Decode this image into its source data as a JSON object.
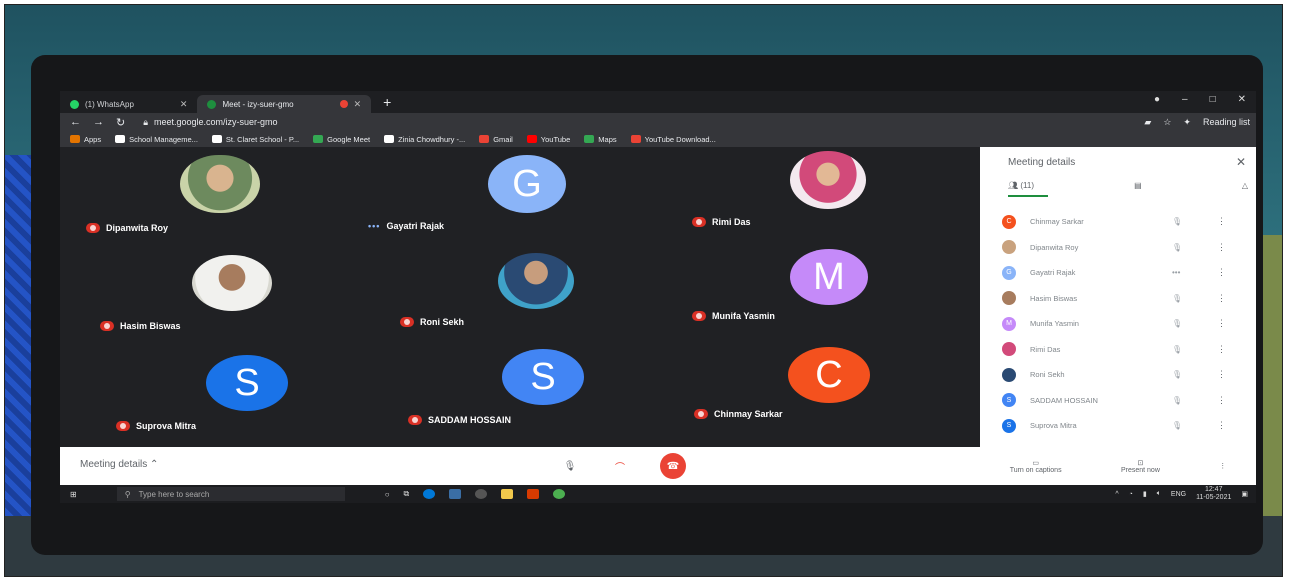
{
  "tabs": [
    {
      "label": "(1) WhatsApp",
      "close": "✕"
    },
    {
      "label": "Meet - izy-suer-gmo",
      "close": "✕"
    }
  ],
  "url": "meet.google.com/izy-suer-gmo",
  "addr_right": "Reading list",
  "bookmarks": [
    "Apps",
    "School Manageme...",
    "St. Claret School - P...",
    "Google Meet",
    "Zinia Chowdhury -...",
    "Gmail",
    "YouTube",
    "Maps",
    "YouTube Download..."
  ],
  "tiles": [
    {
      "name": "Dipanwita Roy"
    },
    {
      "name": "Gayatri Rajak",
      "initial": "G"
    },
    {
      "name": "Rimi Das"
    },
    {
      "name": "Hasim Biswas"
    },
    {
      "name": "Roni Sekh"
    },
    {
      "name": "Munifa Yasmin",
      "initial": "M"
    },
    {
      "name": "Suprova Mitra",
      "initial": "S"
    },
    {
      "name": "SADDAM HOSSAIN",
      "initial": "S"
    },
    {
      "name": "Chinmay Sarkar",
      "initial": "C"
    }
  ],
  "bottom": {
    "meeting_details": "Meeting details"
  },
  "panel": {
    "title": "Meeting details",
    "count": "(11)",
    "participants": [
      {
        "name": "Chinmay Sarkar",
        "initial": "C"
      },
      {
        "name": "Dipanwita Roy",
        "initial": ""
      },
      {
        "name": "Gayatri Rajak",
        "initial": "G"
      },
      {
        "name": "Hasim Biswas",
        "initial": ""
      },
      {
        "name": "Munifa Yasmin",
        "initial": "M"
      },
      {
        "name": "Rimi Das",
        "initial": ""
      },
      {
        "name": "Roni Sekh",
        "initial": ""
      },
      {
        "name": "SADDAM HOSSAIN",
        "initial": "S"
      },
      {
        "name": "Suprova Mitra",
        "initial": "S"
      }
    ],
    "captions": "Turn on captions",
    "present": "Present now"
  },
  "taskbar": {
    "search": "Type here to search",
    "lang": "ENG",
    "time": "12:47",
    "date": "11-05-2021"
  },
  "colors": {
    "end_call": "#ea4335",
    "mic_off": "#d93025",
    "avatar_blue": "#1a73e8"
  }
}
